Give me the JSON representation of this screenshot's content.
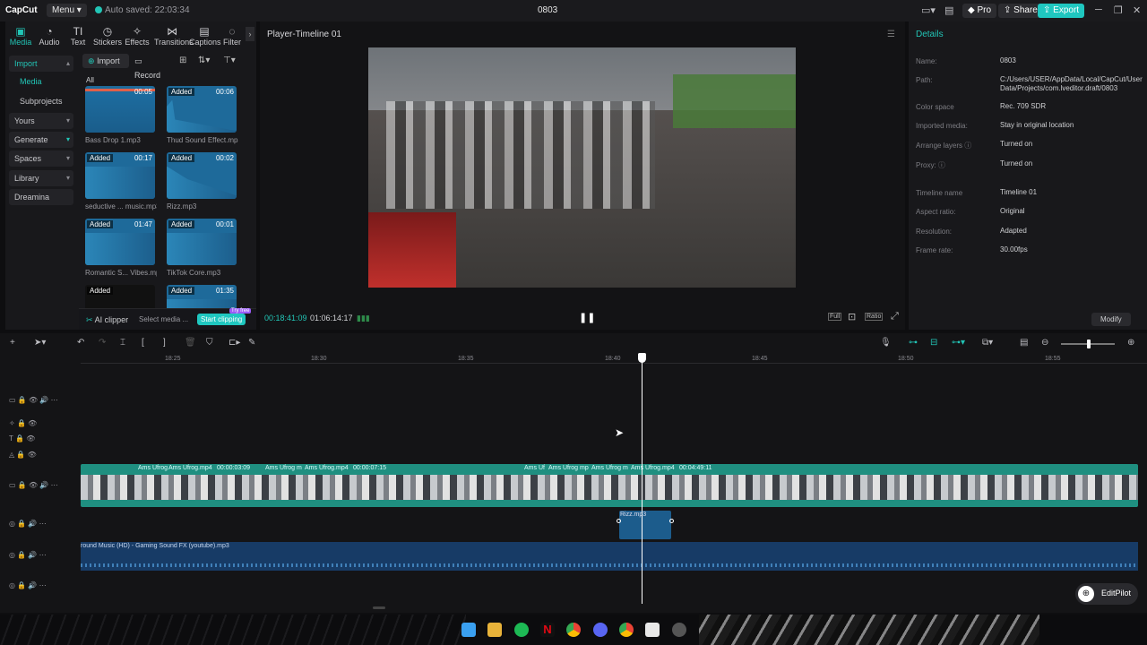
{
  "titlebar": {
    "logo": "CapCut",
    "menu_label": "Menu",
    "autosave": "Auto saved: 22:03:34",
    "project_name": "0803",
    "pro_label": "Pro",
    "share_label": "Share",
    "export_label": "Export"
  },
  "tools": [
    {
      "label": "Media",
      "icon": "media-icon"
    },
    {
      "label": "Audio",
      "icon": "audio-icon"
    },
    {
      "label": "Text",
      "icon": "text-icon"
    },
    {
      "label": "Stickers",
      "icon": "stickers-icon"
    },
    {
      "label": "Effects",
      "icon": "effects-icon"
    },
    {
      "label": "Transitions",
      "icon": "transitions-icon"
    },
    {
      "label": "Captions",
      "icon": "captions-icon"
    },
    {
      "label": "Filter",
      "icon": "filter-icon"
    }
  ],
  "sidenav": {
    "import": "Import",
    "media": "Media",
    "subprojects": "Subprojects",
    "yours": "Yours",
    "generate": "Generate",
    "spaces": "Spaces",
    "library": "Library",
    "dreamina": "Dreamina"
  },
  "media_toolbar": {
    "import_button": "Import",
    "record_button": "Record",
    "filter_all": "All"
  },
  "media_items": [
    {
      "name": "Bass Drop 1.mp3",
      "duration": "00:05",
      "added": ""
    },
    {
      "name": "Thud Sound Effect.mp3",
      "duration": "00:06",
      "added": "Added"
    },
    {
      "name": "seductive ... music.mp3",
      "duration": "00:17",
      "added": "Added"
    },
    {
      "name": "Rizz.mp3",
      "duration": "00:02",
      "added": "Added"
    },
    {
      "name": "Romantic S... Vibes.mp3",
      "duration": "01:47",
      "added": "Added"
    },
    {
      "name": "TikTok Core.mp3",
      "duration": "00:01",
      "added": "Added"
    },
    {
      "name": "",
      "duration": "",
      "added": "Added"
    },
    {
      "name": "",
      "duration": "01:35",
      "added": "Added"
    }
  ],
  "aiclipper": {
    "label": "AI clipper",
    "select_media": "Select media ...",
    "start_button": "Start clipping",
    "badge": "Try free"
  },
  "player": {
    "title": "Player-Timeline 01",
    "current_time": "00:18:41:09",
    "total_time": "01:06:14:17",
    "full_label": "Full",
    "ratio_label": "Ratio"
  },
  "details": {
    "heading": "Details",
    "rows": [
      {
        "label": "Name:",
        "value": "0803"
      },
      {
        "label": "Path:",
        "value": "C:/Users/USER/AppData/Local/CapCut/User Data/Projects/com.lveditor.draft/0803"
      },
      {
        "label": "Color space",
        "value": "Rec. 709 SDR"
      },
      {
        "label": "Imported media:",
        "value": "Stay in original location"
      },
      {
        "label": "Arrange layers",
        "value": "Turned on"
      },
      {
        "label": "Proxy:",
        "value": "Turned on"
      },
      {
        "label": "Timeline name",
        "value": "Timeline 01"
      },
      {
        "label": "Aspect ratio:",
        "value": "Original"
      },
      {
        "label": "Resolution:",
        "value": "Adapted"
      },
      {
        "label": "Frame rate:",
        "value": "30.00fps"
      }
    ],
    "modify_button": "Modify"
  },
  "timeline": {
    "ruler_ticks": [
      "18:25",
      "18:30",
      "18:35",
      "18:40",
      "18:45",
      "18:50",
      "18:55"
    ],
    "clip_labels": [
      "Ams Ufrog",
      "Ams Ufrog.mp4",
      "00:00:03:09",
      "Ams Ufrog m",
      "Ams Ufrog.mp4",
      "00:00:07:15",
      "Ams Uf",
      "Ams Ufrog mp",
      "Ams Ufrog m",
      "Ams Ufrog.mp4",
      "00:04:49:11"
    ],
    "audio_clip": "Rizz.mp3",
    "bg_audio": "round Music (HD) - Gaming Sound FX (youtube).mp3"
  },
  "editpilot_label": "EditPilot"
}
